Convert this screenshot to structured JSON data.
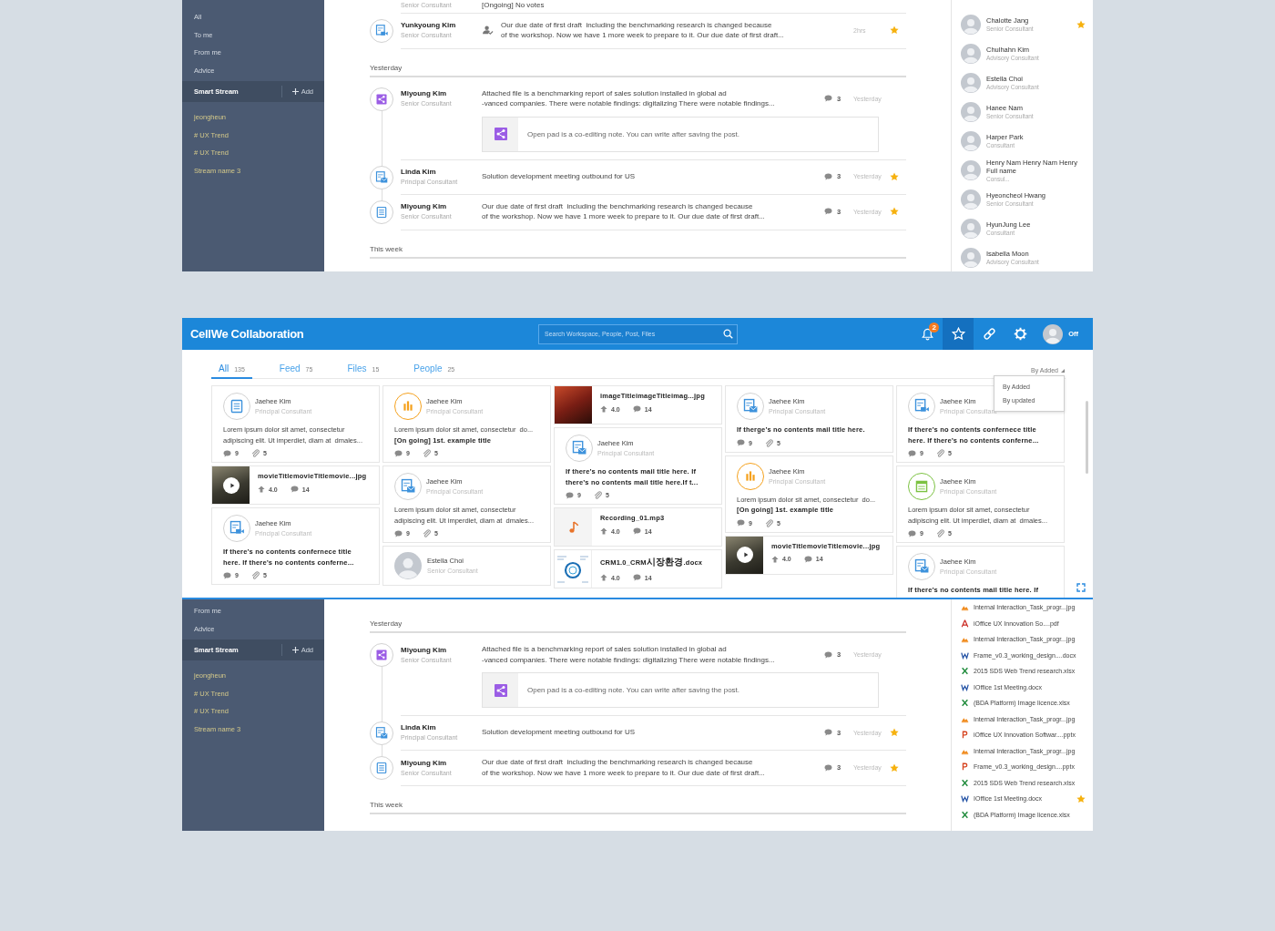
{
  "stream_top": {
    "sidebar": {
      "nav": [
        "All",
        "To me",
        "From me",
        "Advice"
      ],
      "smart_stream": {
        "title": "Smart Stream",
        "add": "Add"
      },
      "streams": [
        "jeongheun",
        "# UX Trend",
        "# UX Trend",
        "Stream name 3"
      ]
    },
    "feed": [
      {
        "kind": "post",
        "role": "Senior Consultant",
        "text": "[Ongoing] No votes"
      },
      {
        "kind": "task",
        "icon": {
          "kind": "video"
        },
        "author": "Yunkyoung Kim",
        "role": "Senior Consultant",
        "text": "Our due date of first draft  including the benchmarking research is changed because\nof the workshop. Now we have 1 more week to prepare to it. Our due date of first draft...",
        "time": "2hrs",
        "starred": true
      },
      {
        "kind": "header",
        "text": "Yesterday"
      },
      {
        "kind": "post",
        "icon": {
          "kind": "share"
        },
        "author": "Miyoung Kim",
        "role": "Senior Consultant",
        "text": "Attached file is a benchmarking report of sales solution installed in global ad\n-vanced companies. There were notable findings: digitalizing There were notable findings...",
        "comments": "3",
        "time": "Yesterday",
        "starred": false,
        "attachment": {
          "kind": "share",
          "text": "Open pad is a co-editing note. You can write after saving the post."
        }
      },
      {
        "kind": "post",
        "icon": {
          "kind": "mail"
        },
        "author": "Linda Kim",
        "role": "Principal Consultant",
        "text": "Solution development meeting outbound for US",
        "comments": "3",
        "time": "Yesterday",
        "starred": true
      },
      {
        "kind": "post",
        "icon": {
          "kind": "doc"
        },
        "author": "Miyoung Kim",
        "role": "Senior Consultant",
        "text": "Our due date of first draft  including the benchmarking research is changed because\nof the workshop. Now we have 1 more week to prepare to it. Our due date of first draft...",
        "comments": "3",
        "time": "Yesterday",
        "starred": true
      },
      {
        "kind": "header",
        "text": "This week"
      }
    ],
    "people": [
      {
        "name": "Chalotte Jang",
        "role": "Senior Consultant",
        "starred": true
      },
      {
        "name": "Chulhahn Kim",
        "role": "Advisory Consultant",
        "starred": false
      },
      {
        "name": "Estella Choi",
        "role": "Advisory Consultant",
        "starred": false
      },
      {
        "name": "Hanee Nam",
        "role": "Senior Consultant",
        "starred": false
      },
      {
        "name": "Harper Park",
        "role": "Consultant",
        "starred": false
      },
      {
        "name": "Henry Nam Henry Nam Henry Full name",
        "role": "Consul...",
        "starred": false
      },
      {
        "name": "Hyeoncheol Hwang",
        "role": "Senior Consultant",
        "starred": false
      },
      {
        "name": "HyunJung Lee",
        "role": "Consultant",
        "starred": false
      },
      {
        "name": "Isabella Moon",
        "role": "Advisory Consultant",
        "starred": false
      }
    ]
  },
  "search_app": {
    "title": "CellWe Collaboration",
    "search": {
      "placeholder": "Search Workspace, People, Post, Files"
    },
    "tools": [
      {
        "kind": "bell",
        "badge": "2",
        "selected": false
      },
      {
        "kind": "star",
        "selected": true
      },
      {
        "kind": "link",
        "selected": false
      },
      {
        "kind": "gear",
        "selected": false
      }
    ],
    "user": {
      "status": "Off"
    },
    "tabs": [
      {
        "label": "All",
        "count": "135",
        "selected": true
      },
      {
        "label": "Feed",
        "count": "75",
        "selected": false
      },
      {
        "label": "Files",
        "count": "15",
        "selected": false
      },
      {
        "label": "People",
        "count": "25",
        "selected": false
      }
    ],
    "sort": {
      "value": "By Added",
      "options": [
        "By Added",
        "By updated"
      ]
    },
    "columns": [
      [
        {
          "kind": "post",
          "icon": {
            "kind": "doc"
          },
          "author": "Jaehee Kim",
          "role": "Principal Consultant",
          "text": "Lorem ipsum dolor sit amet, consectetur\nadipiscing elit. Ut imperdiet, diam at  dmales...",
          "comments": "9",
          "attachments": "5"
        },
        {
          "kind": "file",
          "thumbnail": {
            "kind": "movie"
          },
          "name": "movieTitlemovieTitlemovie...jpg",
          "rating": "4.0",
          "comments": "14"
        },
        {
          "kind": "post",
          "icon": {
            "kind": "video"
          },
          "author": "Jaehee Kim",
          "role": "Principal Consultant",
          "title": "If there’s no contents confernece title\nhere. If there’s no contents conferne...",
          "comments": "9",
          "attachments": "5"
        }
      ],
      [
        {
          "kind": "post",
          "icon": {
            "kind": "chart"
          },
          "author": "Jaehee Kim",
          "role": "Principal Consultant",
          "text": "Lorem ipsum dolor sit amet, consectetur  do...",
          "title": "[On going] 1st. example title",
          "comments": "9",
          "attachments": "5"
        },
        {
          "kind": "post",
          "icon": {
            "kind": "mail"
          },
          "author": "Jaehee Kim",
          "role": "Principal Consultant",
          "text": "Lorem ipsum dolor sit amet, consectetur\nadipiscing elit. Ut imperdiet, diam at  dmales...",
          "comments": "9",
          "attachments": "5"
        },
        {
          "kind": "person",
          "author": "Estella Choi",
          "role": "Senior Consultant"
        }
      ],
      [
        {
          "kind": "file",
          "thumbnail": {
            "kind": "image"
          },
          "name": "imageTitleimageTitleimag...jpg",
          "rating": "4.0",
          "comments": "14"
        },
        {
          "kind": "post",
          "icon": {
            "kind": "mail"
          },
          "author": "Jaehee Kim",
          "role": "Principal Consultant",
          "title": "If there’s no contents mail title here. If\nthere’s no contents mail title here.If t...",
          "comments": "9",
          "attachments": "5"
        },
        {
          "kind": "file",
          "thumbnail": {
            "kind": "audio"
          },
          "name": "Recording_01.mp3",
          "rating": "4.0",
          "comments": "14"
        },
        {
          "kind": "file",
          "thumbnail": {
            "kind": "document"
          },
          "name": "CRM1.0_CRM시장환경.docx",
          "rating": "4.0",
          "comments": "14"
        }
      ],
      [
        {
          "kind": "post",
          "icon": {
            "kind": "mail"
          },
          "author": "Jaehee Kim",
          "role": "Principal Consultant",
          "title": "If therge’s no contents mail title here.",
          "comments": "9",
          "attachments": "5"
        },
        {
          "kind": "post",
          "icon": {
            "kind": "chart"
          },
          "author": "Jaehee Kim",
          "role": "Principal Consultant",
          "text": "Lorem ipsum dolor sit amet, consectetur  do...",
          "title": "[On going] 1st. example title",
          "comments": "9",
          "attachments": "5"
        },
        {
          "kind": "file",
          "thumbnail": {
            "kind": "movie"
          },
          "name": "movieTitlemovieTitlemovie...jpg",
          "rating": "4.0",
          "comments": "14"
        }
      ],
      [
        {
          "kind": "post",
          "icon": {
            "kind": "video"
          },
          "author": "Jaehee Kim",
          "role": "Principal Consultant",
          "title": "If there’s no contents confernece title\nhere. If there’s no contents conferne...",
          "comments": "9",
          "attachments": "5"
        },
        {
          "kind": "post",
          "icon": {
            "kind": "sheet"
          },
          "author": "Jaehee Kim",
          "role": "Principal Consultant",
          "text": "Lorem ipsum dolor sit amet, consectetur\nadipiscing elit. Ut imperdiet, diam at  dmales...",
          "comments": "9",
          "attachments": "5"
        },
        {
          "kind": "post",
          "icon": {
            "kind": "mail"
          },
          "author": "Jaehee Kim",
          "role": "Principal Consultant",
          "title": "If there’s no contents mail title here. If"
        }
      ]
    ]
  },
  "stream_bottom": {
    "sidebar": {
      "nav": [
        "From me",
        "Advice"
      ],
      "smart_stream": {
        "title": "Smart Stream",
        "add": "Add"
      },
      "streams": [
        "jeongheun",
        "# UX Trend",
        "# UX Trend",
        "Stream name 3"
      ]
    },
    "feed": [
      {
        "kind": "header",
        "text": "Yesterday"
      },
      {
        "kind": "post",
        "icon": {
          "kind": "share"
        },
        "author": "Miyoung Kim",
        "role": "Senior Consultant",
        "text": "Attached file is a benchmarking report of sales solution installed in global ad\n-vanced companies. There were notable findings: digitalizing There were notable findings...",
        "comments": "3",
        "time": "Yesterday",
        "starred": false,
        "attachment": {
          "kind": "share",
          "text": "Open pad is a co-editing note. You can write after saving the post."
        }
      },
      {
        "kind": "post",
        "icon": {
          "kind": "mail"
        },
        "author": "Linda Kim",
        "role": "Principal Consultant",
        "text": "Solution development meeting outbound for US",
        "comments": "3",
        "time": "Yesterday",
        "starred": true
      },
      {
        "kind": "post",
        "icon": {
          "kind": "doc"
        },
        "author": "Miyoung Kim",
        "role": "Senior Consultant",
        "text": "Our due date of first draft  including the benchmarking research is changed because\nof the workshop. Now we have 1 more week to prepare to it. Our due date of first draft...",
        "comments": "3",
        "time": "Yesterday",
        "starred": true
      },
      {
        "kind": "header",
        "text": "This week"
      }
    ],
    "files": [
      {
        "kind": "image",
        "name": "Internal Interaction_Task_progr...jpg",
        "starred": false
      },
      {
        "kind": "pdf",
        "name": "iOffice UX Innovation So....pdf",
        "starred": false
      },
      {
        "kind": "image",
        "name": "Internal Interaction_Task_progr...jpg",
        "starred": false
      },
      {
        "kind": "word",
        "name": "Frame_v0.3_working_design....docx",
        "starred": false
      },
      {
        "kind": "excel",
        "name": "2015 SDS Web Trend research.xlsx",
        "starred": false
      },
      {
        "kind": "word",
        "name": "IOffice 1st Meeting.docx",
        "starred": false
      },
      {
        "kind": "excel",
        "name": "(BDA Platform) Image licence.xlsx",
        "starred": false
      },
      {
        "kind": "image",
        "name": "Internal Interaction_Task_progr...jpg",
        "starred": false
      },
      {
        "kind": "ppt",
        "name": "iOffice UX Innovation Softwar....pptx",
        "starred": false
      },
      {
        "kind": "image",
        "name": "Internal Interaction_Task_progr...jpg",
        "starred": false
      },
      {
        "kind": "ppt",
        "name": "Frame_v0.3_working_design....pptx",
        "starred": false
      },
      {
        "kind": "excel",
        "name": "2015 SDS Web Trend research.xlsx",
        "starred": false
      },
      {
        "kind": "word",
        "name": "IOffice 1st Meeting.docx",
        "starred": true
      },
      {
        "kind": "excel",
        "name": "(BDA Platform) Image licence.xlsx",
        "starred": false
      }
    ]
  }
}
